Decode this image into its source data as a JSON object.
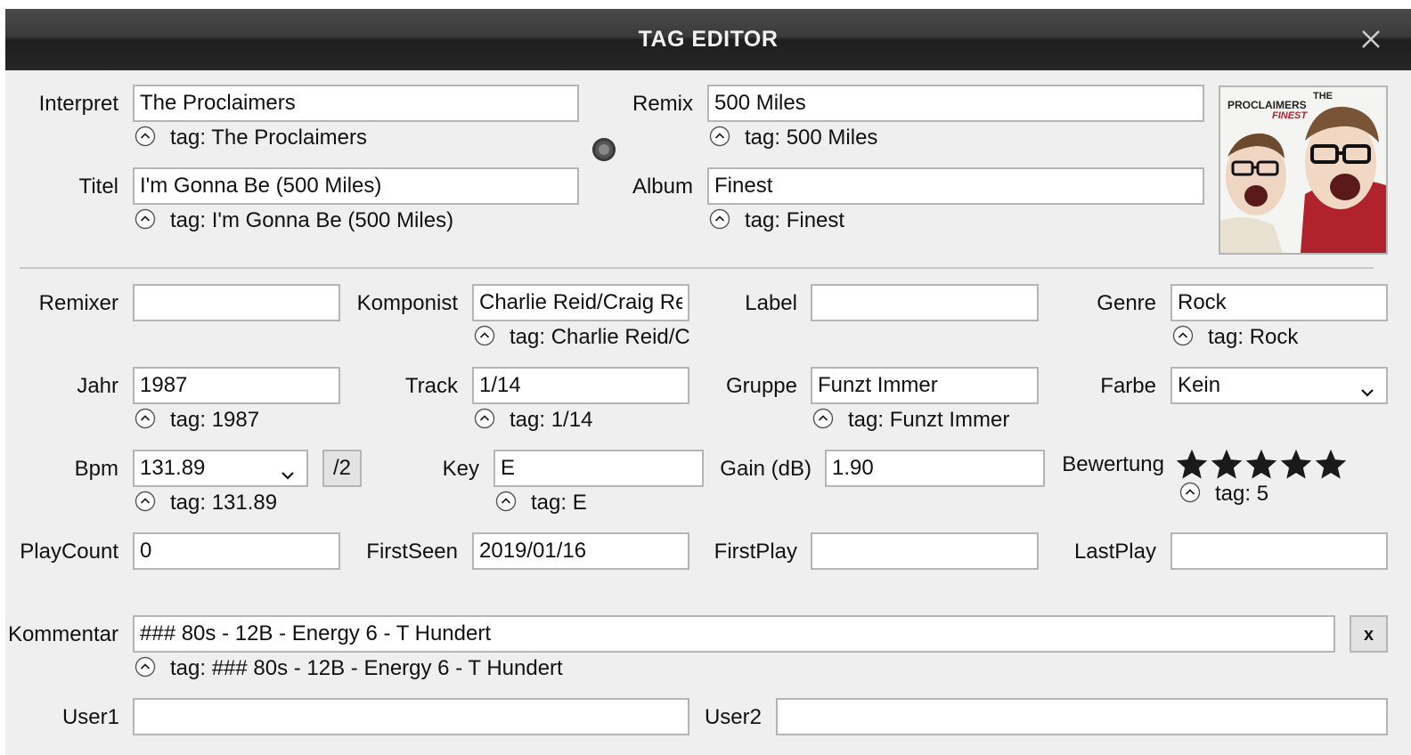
{
  "dialog": {
    "title": "TAG EDITOR",
    "close_glyph": "✕"
  },
  "icons": {
    "close": "close-icon",
    "tag_revert": "chevron-up-circle-icon",
    "dropdown": "chevron-down-icon",
    "star": "star-icon"
  },
  "fields": {
    "interpret": {
      "label": "Interpret",
      "value": "The Proclaimers",
      "tag": "tag: The Proclaimers"
    },
    "titel": {
      "label": "Titel",
      "value": "I'm Gonna Be (500 Miles)",
      "tag": "tag: I'm Gonna Be (500 Miles)"
    },
    "remix": {
      "label": "Remix",
      "value": "500 Miles",
      "tag": "tag: 500 Miles"
    },
    "album": {
      "label": "Album",
      "value": "Finest",
      "tag": "tag: Finest"
    },
    "remixer": {
      "label": "Remixer",
      "value": ""
    },
    "komponist": {
      "label": "Komponist",
      "value": "Charlie Reid/Craig Reid",
      "tag": "tag: Charlie Reid/Craig Reid"
    },
    "label": {
      "label": "Label",
      "value": ""
    },
    "genre": {
      "label": "Genre",
      "value": "Rock",
      "tag": "tag: Rock"
    },
    "jahr": {
      "label": "Jahr",
      "value": "1987",
      "tag": "tag: 1987"
    },
    "track": {
      "label": "Track",
      "value": "1/14",
      "tag": "tag: 1/14"
    },
    "gruppe": {
      "label": "Gruppe",
      "value": "Funzt Immer",
      "tag": "tag: Funzt Immer"
    },
    "farbe": {
      "label": "Farbe",
      "value": "Kein"
    },
    "bpm": {
      "label": "Bpm",
      "value": "131.89",
      "tag": "tag: 131.89",
      "half_button": "/2"
    },
    "key": {
      "label": "Key",
      "value": "E",
      "tag": "tag: E"
    },
    "gain": {
      "label": "Gain (dB)",
      "value": "1.90"
    },
    "bewertung": {
      "label": "Bewertung",
      "rating": 5,
      "max": 5,
      "tag": "tag: 5"
    },
    "playcount": {
      "label": "PlayCount",
      "value": "0"
    },
    "firstseen": {
      "label": "FirstSeen",
      "value": "2019/01/16"
    },
    "firstplay": {
      "label": "FirstPlay",
      "value": ""
    },
    "lastplay": {
      "label": "LastPlay",
      "value": ""
    },
    "kommentar": {
      "label": "Kommentar",
      "value": "### 80s - 12B - Energy 6 - T Hundert",
      "tag": "tag: ### 80s - 12B - Energy 6 - T Hundert",
      "clear_button": "x"
    },
    "user1": {
      "label": "User1",
      "value": ""
    },
    "user2": {
      "label": "User2",
      "value": ""
    }
  },
  "cover": {
    "line1": "THE",
    "line2": "PROCLAIMERS",
    "line3": "FINEST",
    "bg_left": "#f4f4f2",
    "bg_right": "#b0232c"
  }
}
